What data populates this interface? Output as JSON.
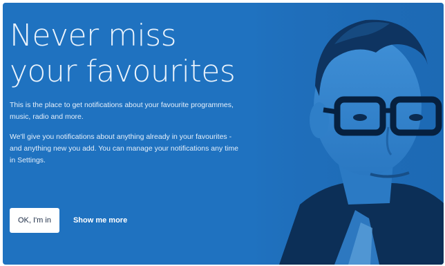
{
  "promo": {
    "title_line1": "Never miss",
    "title_line2": "your favourites",
    "paragraph1": "This is the place to get notifications about your favourite programmes, music, radio and more.",
    "paragraph2": "We'll give you notifications about anything already in your favourites - and anything new you add. You can manage your notifications any time in Settings.",
    "primary_button": "OK, I'm in",
    "secondary_link": "Show me more",
    "background_color": "#1f72c0"
  }
}
